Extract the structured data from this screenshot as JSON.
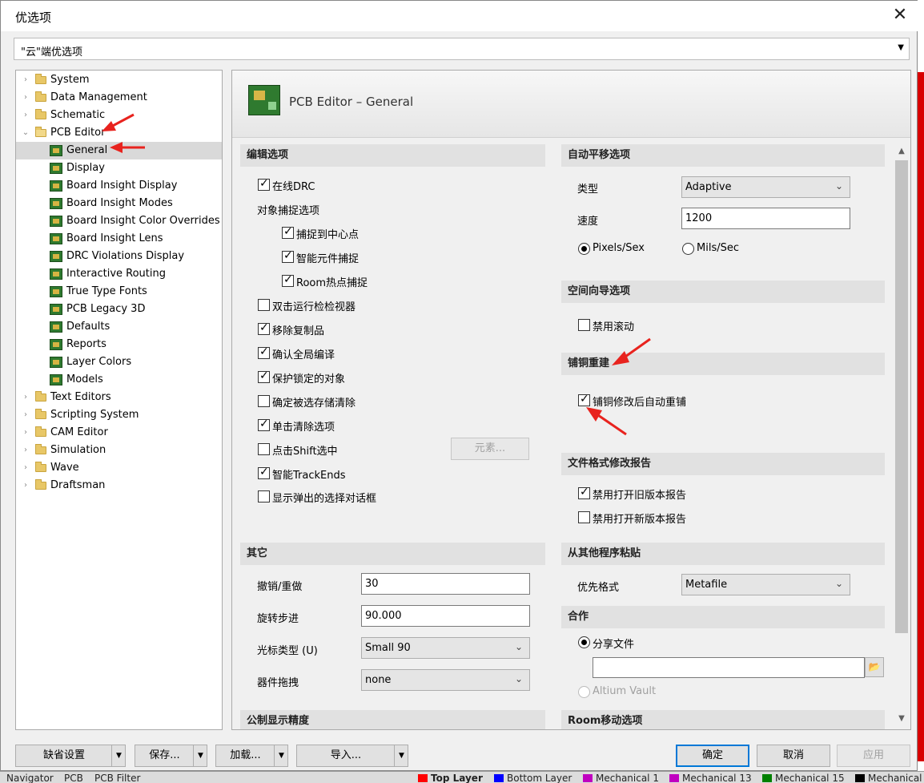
{
  "dialog": {
    "title": "优选项",
    "close_glyph": "✕",
    "cloud_select": "\"云\"端优选项"
  },
  "tree": {
    "items": [
      {
        "label": "System",
        "kind": "folder",
        "expander": "›"
      },
      {
        "label": "Data Management",
        "kind": "folder",
        "expander": "›"
      },
      {
        "label": "Schematic",
        "kind": "folder",
        "expander": "›"
      },
      {
        "label": "PCB Editor",
        "kind": "folder-open",
        "expander": "⌄"
      },
      {
        "label": "General",
        "kind": "pcb"
      },
      {
        "label": "Display",
        "kind": "pcb"
      },
      {
        "label": "Board Insight Display",
        "kind": "pcb"
      },
      {
        "label": "Board Insight Modes",
        "kind": "pcb"
      },
      {
        "label": "Board Insight Color Overrides",
        "kind": "pcb"
      },
      {
        "label": "Board Insight Lens",
        "kind": "pcb"
      },
      {
        "label": "DRC Violations Display",
        "kind": "pcb"
      },
      {
        "label": "Interactive Routing",
        "kind": "pcb"
      },
      {
        "label": "True Type Fonts",
        "kind": "pcb"
      },
      {
        "label": "PCB Legacy 3D",
        "kind": "pcb"
      },
      {
        "label": "Defaults",
        "kind": "pcb"
      },
      {
        "label": "Reports",
        "kind": "pcb"
      },
      {
        "label": "Layer Colors",
        "kind": "pcb"
      },
      {
        "label": "Models",
        "kind": "pcb"
      },
      {
        "label": "Text Editors",
        "kind": "folder",
        "expander": "›"
      },
      {
        "label": "Scripting System",
        "kind": "folder",
        "expander": "›"
      },
      {
        "label": "CAM Editor",
        "kind": "folder",
        "expander": "›"
      },
      {
        "label": "Simulation",
        "kind": "folder",
        "expander": "›"
      },
      {
        "label": "Wave",
        "kind": "folder",
        "expander": "›"
      },
      {
        "label": "Draftsman",
        "kind": "folder",
        "expander": "›"
      }
    ],
    "selected_index": 4
  },
  "panel": {
    "title": "PCB Editor – General",
    "edit_options": {
      "header": "编辑选项",
      "online_drc": {
        "label": "在线DRC",
        "checked": true
      },
      "snap_header": "对象捕捉选项",
      "snap_center": {
        "label": "捕捉到中心点",
        "checked": true
      },
      "smart_component_snap": {
        "label": "智能元件捕捉",
        "checked": true
      },
      "room_hotspot_snap": {
        "label": "Room热点捕捉",
        "checked": true
      },
      "dblclick_inspector": {
        "label": "双击运行检检视器",
        "checked": false
      },
      "remove_duplicates": {
        "label": "移除复制品",
        "checked": true
      },
      "confirm_global_compile": {
        "label": "确认全局编译",
        "checked": true
      },
      "protect_locked": {
        "label": "保护锁定的对象",
        "checked": true
      },
      "confirm_clear_selection": {
        "label": "确定被选存储清除",
        "checked": false
      },
      "click_clear_selection": {
        "label": "单击清除选项",
        "checked": true
      },
      "shift_click_select": {
        "label": "点击Shift选中",
        "checked": false
      },
      "elements_button": "元素...",
      "smart_trackends": {
        "label": "智能TrackEnds",
        "checked": true
      },
      "show_popup_dialog": {
        "label": "显示弹出的选择对话框",
        "checked": false
      }
    },
    "other": {
      "header": "其它",
      "undo_label": "撤销/重做",
      "undo_value": "30",
      "rotation_label": "旋转步进",
      "rotation_value": "90.000",
      "cursor_label": "光标类型 (U)",
      "cursor_value": "Small 90",
      "drag_label": "器件拖拽",
      "drag_value": "none"
    },
    "metric_header": "公制显示精度",
    "autopan": {
      "header": "自动平移选项",
      "type_label": "类型",
      "type_value": "Adaptive",
      "speed_label": "速度",
      "speed_value": "1200",
      "pixels_label": "Pixels/Sex",
      "pixels_checked": true,
      "mils_label": "Mils/Sec",
      "mils_checked": false
    },
    "space_nav": {
      "header": "空间向导选项",
      "disable_scroll": {
        "label": "禁用滚动",
        "checked": false
      }
    },
    "pour_rebuild": {
      "header": "铺铜重建",
      "auto_repour": {
        "label": "铺铜修改后自动重铺",
        "checked": true
      }
    },
    "file_format": {
      "header": "文件格式修改报告",
      "disable_old": {
        "label": "禁用打开旧版本报告",
        "checked": true
      },
      "disable_new": {
        "label": "禁用打开新版本报告",
        "checked": false
      }
    },
    "paste": {
      "header": "从其他程序粘贴",
      "format_label": "优先格式",
      "format_value": "Metafile"
    },
    "collab": {
      "header": "合作",
      "share_file": "分享文件",
      "share_path": "",
      "folder_glyph": "📂",
      "altium_vault": "Altium Vault"
    },
    "room_move_header": "Room移动选项"
  },
  "footer": {
    "defaults": "缺省设置",
    "save": "保存...",
    "load": "加载...",
    "import": "导入...",
    "ok": "确定",
    "cancel": "取消",
    "apply": "应用",
    "split_glyph": "▼"
  },
  "background": {
    "statusbar_items": [
      "Navigator",
      "PCB",
      "PCB Filter",
      "Top Layer",
      "Bottom Layer",
      "Mechanical 1",
      "Mechanical 13",
      "Mechanical 15",
      "Mechanical"
    ],
    "layer_colors": {
      "top": "#ff0000",
      "bottom": "#0000ff",
      "mech1": "#c000c0",
      "mech13": "#c000c0",
      "mech15": "#008000",
      "mech": "#000000"
    }
  },
  "colors": {
    "annotation_arrow": "#e8231e",
    "selection": "#d9d9d9",
    "default_button_border": "#0078d7"
  }
}
